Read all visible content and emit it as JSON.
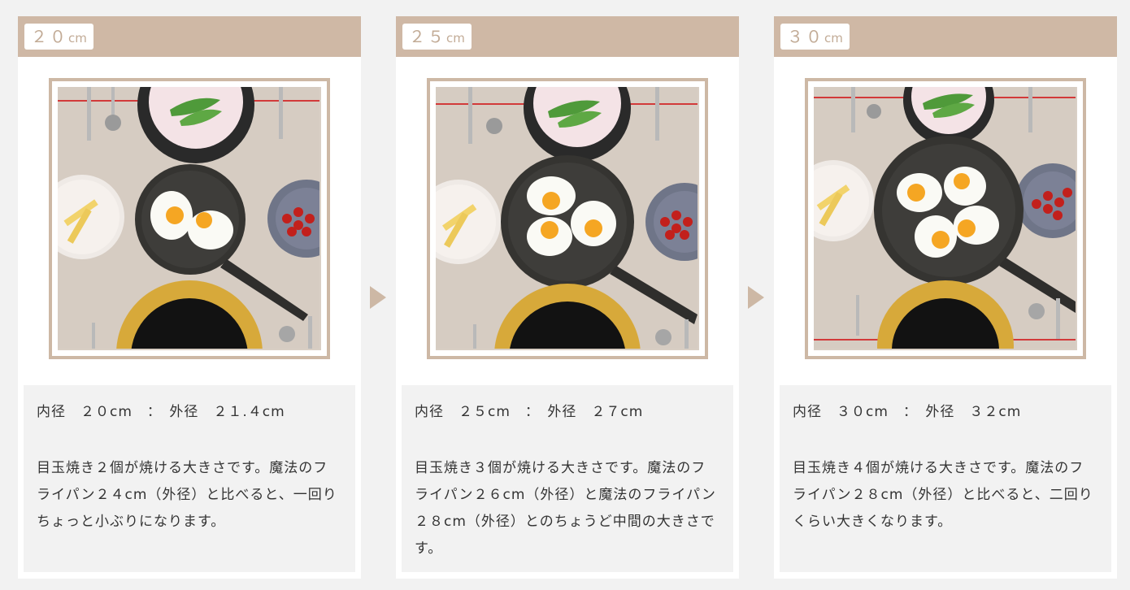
{
  "cards": [
    {
      "size_num": "２０",
      "size_unit": "cm",
      "dimensions": "内径　２０cm　：　外径　２１.４cm",
      "description": "目玉焼き２個が焼ける大きさです。魔法のフライパン２４cm（外径）と比べると、一回りちょっと小ぶりになります。",
      "eggs": 2
    },
    {
      "size_num": "２５",
      "size_unit": "cm",
      "dimensions": "内径　２５cm　：　外径　２７cm",
      "description": "目玉焼き３個が焼ける大きさです。魔法のフライパン２６cm（外径）と魔法のフライパン２８cm（外径）とのちょうど中間の大きさです。",
      "eggs": 3
    },
    {
      "size_num": "３０",
      "size_unit": "cm",
      "dimensions": "内径　３０cm　：　外径　３２cm",
      "description": "目玉焼き４個が焼ける大きさです。魔法のフライパン２８cm（外径）と比べると、二回りくらい大きくなります。",
      "eggs": 4
    }
  ],
  "colors": {
    "header": "#cfb8a5",
    "label_text": "#c2ab96",
    "frame": "#cdb8a5",
    "page_bg": "#f2f2f2"
  },
  "icons": [
    "arrow-right-icon"
  ]
}
